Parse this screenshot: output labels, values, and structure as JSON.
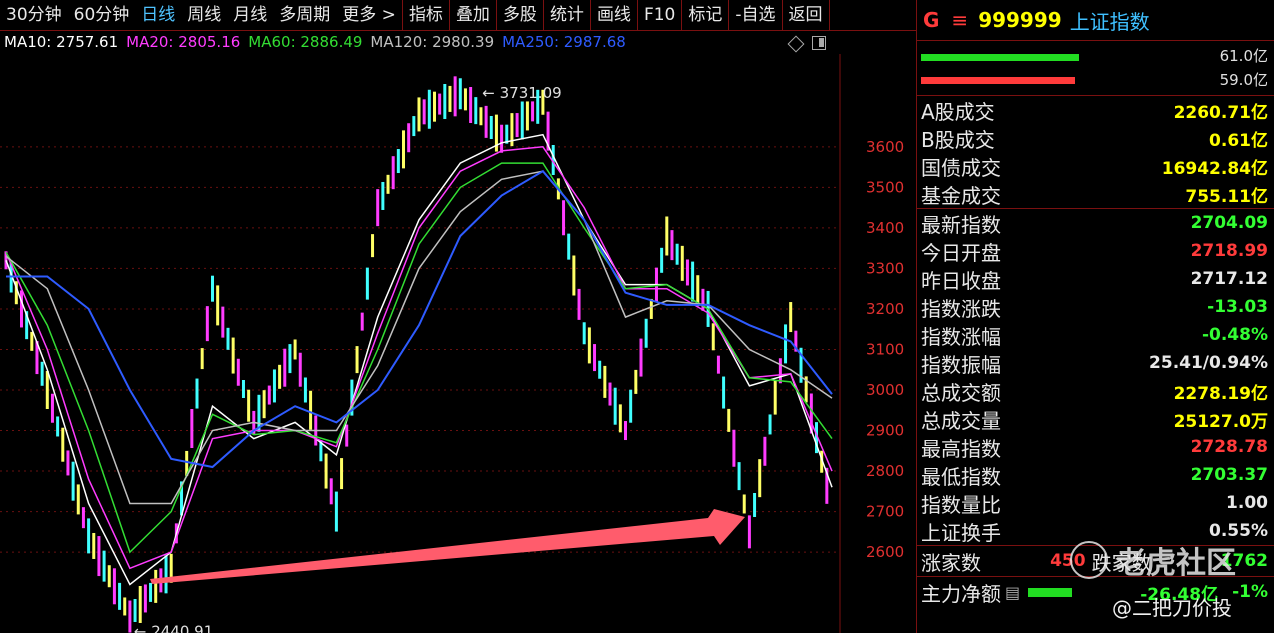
{
  "toolbar": {
    "items": [
      "30分钟",
      "60分钟",
      "日线",
      "周线",
      "月线",
      "多周期",
      "更多 >",
      "指标",
      "叠加",
      "多股",
      "统计",
      "画线",
      "F10",
      "标记",
      "-自选",
      "返回"
    ],
    "active": "日线"
  },
  "ma_legend": [
    {
      "label": "MA10: 2757.61",
      "color": "#ffffff"
    },
    {
      "label": "MA20: 2805.16",
      "color": "#ff3cff"
    },
    {
      "label": "MA60: 2886.49",
      "color": "#33dd33"
    },
    {
      "label": "MA120: 2980.39",
      "color": "#c0c0c0"
    },
    {
      "label": "MA250: 2987.68",
      "color": "#2e5bff"
    }
  ],
  "chart_annotations": {
    "high": "3731.09",
    "low": "2440.91"
  },
  "chart_data": {
    "type": "line",
    "title": "",
    "y_ticks": [
      2600,
      2700,
      2800,
      2900,
      3000,
      3100,
      3200,
      3300,
      3400,
      3500,
      3600
    ],
    "ylim": [
      2430,
      3760
    ],
    "x": [
      0,
      5,
      10,
      15,
      20,
      25,
      30,
      35,
      40,
      45,
      50,
      55,
      60,
      65,
      70,
      75,
      80,
      85,
      90,
      95,
      100
    ],
    "series": [
      {
        "name": "MA10",
        "color": "#ffffff",
        "values": [
          3320,
          3050,
          2720,
          2520,
          2600,
          2960,
          2880,
          2920,
          2840,
          3180,
          3420,
          3560,
          3610,
          3630,
          3420,
          3260,
          3260,
          3200,
          3010,
          3040,
          2760
        ]
      },
      {
        "name": "MA20",
        "color": "#ff3cff",
        "values": [
          3340,
          3100,
          2780,
          2560,
          2600,
          2880,
          2900,
          2900,
          2860,
          3140,
          3400,
          3540,
          3590,
          3600,
          3450,
          3250,
          3250,
          3190,
          3030,
          3040,
          2800
        ]
      },
      {
        "name": "MA60",
        "color": "#33dd33",
        "values": [
          3340,
          3160,
          2900,
          2600,
          2700,
          2940,
          2890,
          2900,
          2870,
          3100,
          3360,
          3500,
          3560,
          3560,
          3400,
          3250,
          3260,
          3200,
          3030,
          3020,
          2880
        ]
      },
      {
        "name": "MA120",
        "color": "#c0c0c0",
        "values": [
          3330,
          3250,
          3000,
          2720,
          2720,
          2900,
          2920,
          2900,
          2900,
          3060,
          3300,
          3440,
          3520,
          3540,
          3420,
          3180,
          3220,
          3210,
          3100,
          3050,
          2980
        ]
      },
      {
        "name": "MA250",
        "color": "#2e5bff",
        "values": [
          3280,
          3280,
          3200,
          3000,
          2830,
          2810,
          2900,
          2960,
          2920,
          3000,
          3160,
          3380,
          3480,
          3540,
          3420,
          3240,
          3210,
          3210,
          3160,
          3120,
          2990
        ]
      }
    ],
    "price_path": [
      3320,
      3000,
      2640,
      2441,
      2560,
      3250,
      2920,
      3100,
      2700,
      3450,
      3680,
      3731,
      3620,
      3710,
      3140,
      2900,
      3380,
      3200,
      2650,
      3180,
      2704
    ]
  },
  "panel": {
    "g": "G",
    "menu": "≡",
    "code": "999999",
    "name": "上证指数",
    "bar1_val": "61.0亿",
    "bar2_val": "59.0亿",
    "bar1_pct": 0.72,
    "bar2_pct": 0.7,
    "turnover": [
      {
        "label": "A股成交",
        "value": "2260.71亿",
        "color": "#ffff00"
      },
      {
        "label": "B股成交",
        "value": "0.61亿",
        "color": "#ffff00"
      },
      {
        "label": "国债成交",
        "value": "16942.84亿",
        "color": "#ffff00"
      },
      {
        "label": "基金成交",
        "value": "755.11亿",
        "color": "#ffff00"
      }
    ],
    "stats": [
      {
        "label": "最新指数",
        "value": "2704.09",
        "color": "#33ff33"
      },
      {
        "label": "今日开盘",
        "value": "2718.99",
        "color": "#ff3b3b"
      },
      {
        "label": "昨日收盘",
        "value": "2717.12",
        "color": "#e8e8e8"
      },
      {
        "label": "指数涨跌",
        "value": "-13.03",
        "color": "#33ff33"
      },
      {
        "label": "指数涨幅",
        "value": "-0.48%",
        "color": "#33ff33"
      },
      {
        "label": "指数振幅",
        "value": "25.41/0.94%",
        "color": "#e8e8e8"
      },
      {
        "label": "总成交额",
        "value": "2278.19亿",
        "color": "#ffff00"
      },
      {
        "label": "总成交量",
        "value": "25127.0万",
        "color": "#ffff00"
      },
      {
        "label": "最高指数",
        "value": "2728.78",
        "color": "#ff3b3b"
      },
      {
        "label": "最低指数",
        "value": "2703.37",
        "color": "#33ff33"
      },
      {
        "label": "指数量比",
        "value": "1.00",
        "color": "#e8e8e8"
      },
      {
        "label": "上证换手",
        "value": "0.55%",
        "color": "#e8e8e8"
      }
    ],
    "up_label": "涨家数",
    "up_value": "450",
    "down_label": "跌家数",
    "down_value": "1762",
    "main_label": "主力净额",
    "main_value": "-26.48亿",
    "main_pct": "-1%"
  },
  "watermark": {
    "brand": "老虎社区",
    "author": "@二把刀价投"
  }
}
